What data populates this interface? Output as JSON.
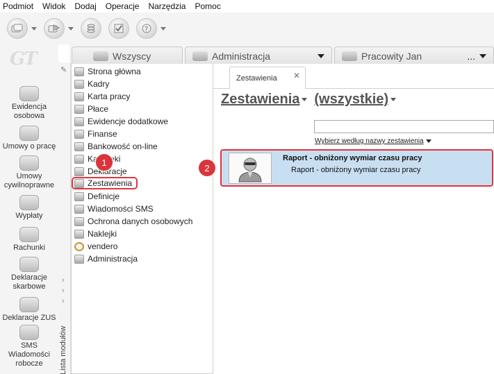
{
  "menubar": [
    "Podmiot",
    "Widok",
    "Dodaj",
    "Operacje",
    "Narzędzia",
    "Pomoc"
  ],
  "toolbar": {
    "buttons": [
      {
        "icon": "cards-icon",
        "has_dropdown": true
      },
      {
        "icon": "cards-arrow-icon",
        "has_dropdown": true
      },
      {
        "icon": "coins-icon",
        "has_dropdown": false
      },
      {
        "icon": "checklist-icon",
        "has_dropdown": false
      },
      {
        "icon": "help-icon",
        "has_dropdown": true
      }
    ]
  },
  "logo": "GT",
  "left_modules": [
    {
      "label": "Ewidencja osobowa",
      "icon": "person-icon"
    },
    {
      "label": "Umowy o pracę",
      "icon": "contract-icon"
    },
    {
      "label": "Umowy cywilnoprawne",
      "icon": "civil-contract-icon"
    },
    {
      "label": "Wypłaty",
      "icon": "payout-icon"
    },
    {
      "label": "Rachunki",
      "icon": "bills-icon"
    },
    {
      "label": "Deklaracje skarbowe",
      "icon": "tax-declarations-icon"
    },
    {
      "label": "Deklaracje ZUS",
      "icon": "zus-icon"
    },
    {
      "label": "SMS Wiadomości robocze",
      "icon": "sms-icon"
    }
  ],
  "strip": {
    "label": "Lista modułów"
  },
  "top_tabs": [
    {
      "label": "Wszyscy",
      "icon": "people-group-icon"
    },
    {
      "label": "Administracja",
      "icon": "people-icon",
      "dropdown": true
    },
    {
      "label": "Pracowity Jan",
      "icon": "person-icon",
      "dropdown": true,
      "more": "..."
    }
  ],
  "module_list": {
    "items": [
      "Strona główna",
      "Kadry",
      "Karta pracy",
      "Płace",
      "Ewidencje dodatkowe",
      "Finanse",
      "Bankowość on-line",
      "Kartoteki",
      "Deklaracje",
      "Zestawienia",
      "Definicje",
      "Wiadomości SMS",
      "Ochrona danych osobowych",
      "Naklejki",
      "vendero",
      "Administracja"
    ],
    "selected": "Zestawienia"
  },
  "content": {
    "tab_label": "Zestawienia",
    "heading_left": "Zestawienia",
    "heading_right": "(wszystkie)",
    "search_value": "",
    "search_label": "Wybierz według nazwy zestawienia",
    "rows": [
      {
        "title": "Raport - obniżony wymiar czasu pracy",
        "subtitle": "Raport - obniżony wymiar czasu pracy",
        "icon": "person-report-icon"
      }
    ]
  },
  "annotations": [
    "1",
    "2"
  ],
  "colors": {
    "highlight": "#e0353b",
    "row_selected": "#c8dff2",
    "badge": "#d9353b"
  }
}
